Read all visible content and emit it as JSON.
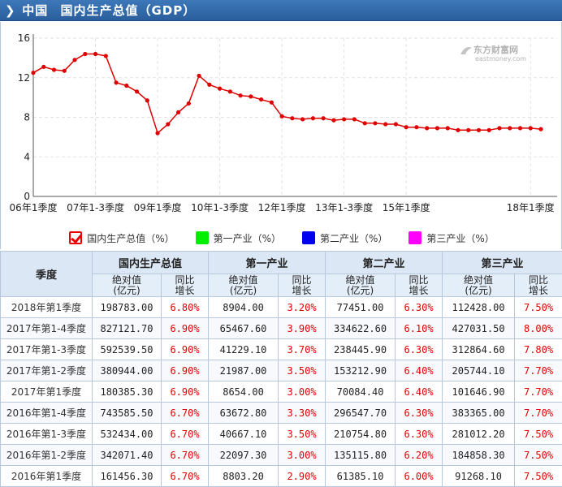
{
  "header": {
    "region": "中国",
    "title": "国内生产总值（GDP）"
  },
  "watermark": {
    "brand": "东方财富网",
    "domain": "eastmoney.com"
  },
  "chart_data": {
    "type": "line",
    "x_tick_labels": [
      "06年1季度",
      "07年1-3季度",
      "09年1季度",
      "10年1-3季度",
      "12年1季度",
      "13年1-3季度",
      "15年1季度",
      "18年1季度"
    ],
    "x_tick_index": [
      0,
      6,
      12,
      18,
      24,
      30,
      36,
      48
    ],
    "yticks": [
      0,
      4,
      8,
      12,
      16
    ],
    "ylim": [
      0,
      16
    ],
    "grid": true,
    "series": [
      {
        "name": "国内生产总值（%）",
        "color": "#e00000",
        "values": [
          12.5,
          13.1,
          12.8,
          12.7,
          13.8,
          14.4,
          14.4,
          14.2,
          11.5,
          11.2,
          10.6,
          9.7,
          6.4,
          7.3,
          8.5,
          9.4,
          12.2,
          11.3,
          10.9,
          10.6,
          10.2,
          10.1,
          9.8,
          9.5,
          8.1,
          7.9,
          7.8,
          7.9,
          7.9,
          7.7,
          7.8,
          7.8,
          7.4,
          7.4,
          7.3,
          7.3,
          7.0,
          7.0,
          6.9,
          6.9,
          6.9,
          6.7,
          6.7,
          6.7,
          6.7,
          6.9,
          6.9,
          6.9,
          6.9,
          6.8
        ]
      }
    ]
  },
  "legend": [
    {
      "label": "国内生产总值（%）",
      "color": "#e00000",
      "checked": true
    },
    {
      "label": "第一产业（%）",
      "color": "#00ee00",
      "checked": false
    },
    {
      "label": "第二产业（%）",
      "color": "#0000ee",
      "checked": false
    },
    {
      "label": "第三产业（%）",
      "color": "#ff00ff",
      "checked": false
    }
  ],
  "table": {
    "quarter_header": "季度",
    "groups": [
      "国内生产总值",
      "第一产业",
      "第二产业",
      "第三产业"
    ],
    "sub_abs_line1": "绝对值",
    "sub_abs_line2": "(亿元)",
    "sub_yoy_line1": "同比",
    "sub_yoy_line2": "增长",
    "rows": [
      {
        "quarter": "2018年第1季度",
        "gdp": "198783.00",
        "gdp_yoy": "6.80%",
        "p1": "8904.00",
        "p1_yoy": "3.20%",
        "p2": "77451.00",
        "p2_yoy": "6.30%",
        "p3": "112428.00",
        "p3_yoy": "7.50%"
      },
      {
        "quarter": "2017年第1-4季度",
        "gdp": "827121.70",
        "gdp_yoy": "6.90%",
        "p1": "65467.60",
        "p1_yoy": "3.90%",
        "p2": "334622.60",
        "p2_yoy": "6.10%",
        "p3": "427031.50",
        "p3_yoy": "8.00%"
      },
      {
        "quarter": "2017年第1-3季度",
        "gdp": "592539.50",
        "gdp_yoy": "6.90%",
        "p1": "41229.10",
        "p1_yoy": "3.70%",
        "p2": "238445.90",
        "p2_yoy": "6.30%",
        "p3": "312864.60",
        "p3_yoy": "7.80%"
      },
      {
        "quarter": "2017年第1-2季度",
        "gdp": "380944.00",
        "gdp_yoy": "6.90%",
        "p1": "21987.00",
        "p1_yoy": "3.50%",
        "p2": "153212.90",
        "p2_yoy": "6.40%",
        "p3": "205744.10",
        "p3_yoy": "7.70%"
      },
      {
        "quarter": "2017年第1季度",
        "gdp": "180385.30",
        "gdp_yoy": "6.90%",
        "p1": "8654.00",
        "p1_yoy": "3.00%",
        "p2": "70084.40",
        "p2_yoy": "6.40%",
        "p3": "101646.90",
        "p3_yoy": "7.70%"
      },
      {
        "quarter": "2016年第1-4季度",
        "gdp": "743585.50",
        "gdp_yoy": "6.70%",
        "p1": "63672.80",
        "p1_yoy": "3.30%",
        "p2": "296547.70",
        "p2_yoy": "6.30%",
        "p3": "383365.00",
        "p3_yoy": "7.70%"
      },
      {
        "quarter": "2016年第1-3季度",
        "gdp": "532434.00",
        "gdp_yoy": "6.70%",
        "p1": "40667.10",
        "p1_yoy": "3.50%",
        "p2": "210754.80",
        "p2_yoy": "6.30%",
        "p3": "281012.20",
        "p3_yoy": "7.50%"
      },
      {
        "quarter": "2016年第1-2季度",
        "gdp": "342071.40",
        "gdp_yoy": "6.70%",
        "p1": "22097.30",
        "p1_yoy": "3.00%",
        "p2": "135115.80",
        "p2_yoy": "6.20%",
        "p3": "184858.30",
        "p3_yoy": "7.50%"
      },
      {
        "quarter": "2016年第1季度",
        "gdp": "161456.30",
        "gdp_yoy": "6.70%",
        "p1": "8803.20",
        "p1_yoy": "2.90%",
        "p2": "61385.10",
        "p2_yoy": "6.00%",
        "p3": "91268.10",
        "p3_yoy": "7.50%"
      }
    ]
  }
}
